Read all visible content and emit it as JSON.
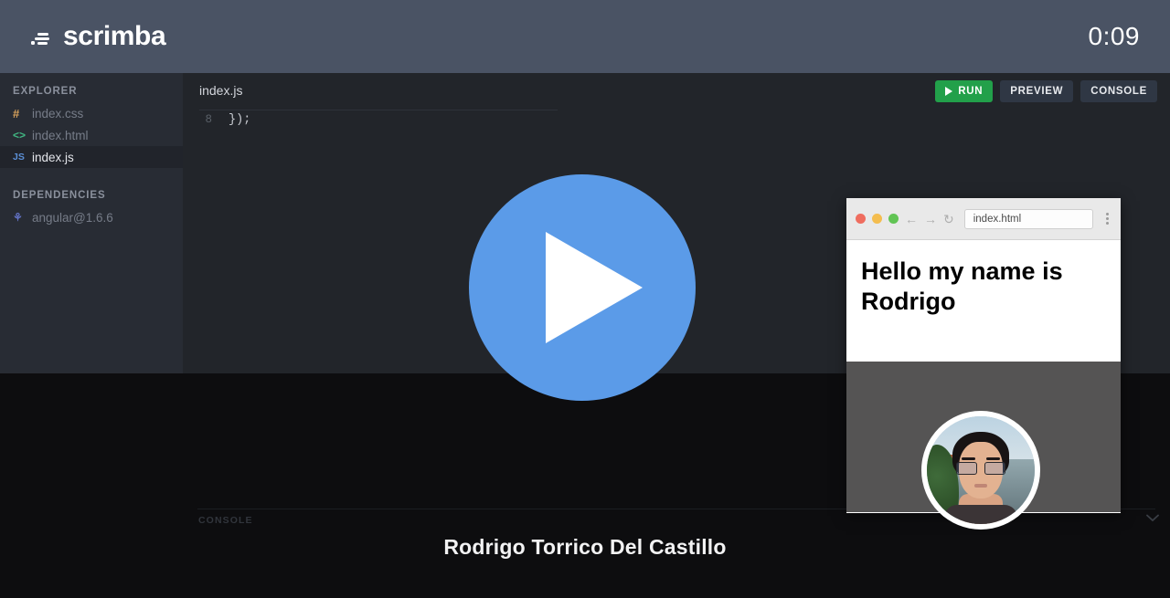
{
  "header": {
    "brand": "scrimba",
    "logo_icon": "scrimba-logo-icon",
    "timer": "0:09"
  },
  "sidebar": {
    "explorer_label": "EXPLORER",
    "files": [
      {
        "name": "index.css",
        "icon": "#",
        "icon_name": "css-file-icon",
        "selected": false
      },
      {
        "name": "index.html",
        "icon": "<>",
        "icon_name": "html-file-icon",
        "selected": false
      },
      {
        "name": "index.js",
        "icon": "JS",
        "icon_name": "js-file-icon",
        "selected": true
      }
    ],
    "dependencies_label": "DEPENDENCIES",
    "dependencies": [
      {
        "name": "angular@1.6.6",
        "icon": "⚘",
        "icon_name": "package-icon"
      }
    ]
  },
  "editor": {
    "tab_label": "index.js",
    "lines": [
      {
        "number": "8",
        "text": "});"
      }
    ]
  },
  "toolbar": {
    "run_label": "RUN",
    "run_icon": "play-icon",
    "preview_label": "PREVIEW",
    "console_label": "CONSOLE",
    "run_color": "#22a04a"
  },
  "player": {
    "play_icon": "play-button-icon",
    "accent_color": "#5b9be8"
  },
  "console_panel": {
    "label": "CONSOLE",
    "collapse_icon": "chevron-down-icon"
  },
  "preview": {
    "window_controls": {
      "close": "close-traffic-light",
      "minimize": "minimize-traffic-light",
      "maximize": "maximize-traffic-light"
    },
    "back_icon": "←",
    "forward_icon": "→",
    "reload_icon": "↻",
    "menu_icon": "kebab-menu-icon",
    "url": "index.html",
    "heading": "Hello my name is Rodrigo",
    "avatar_alt": "profile-photo"
  },
  "credit": {
    "name": "Rodrigo Torrico Del Castillo"
  }
}
